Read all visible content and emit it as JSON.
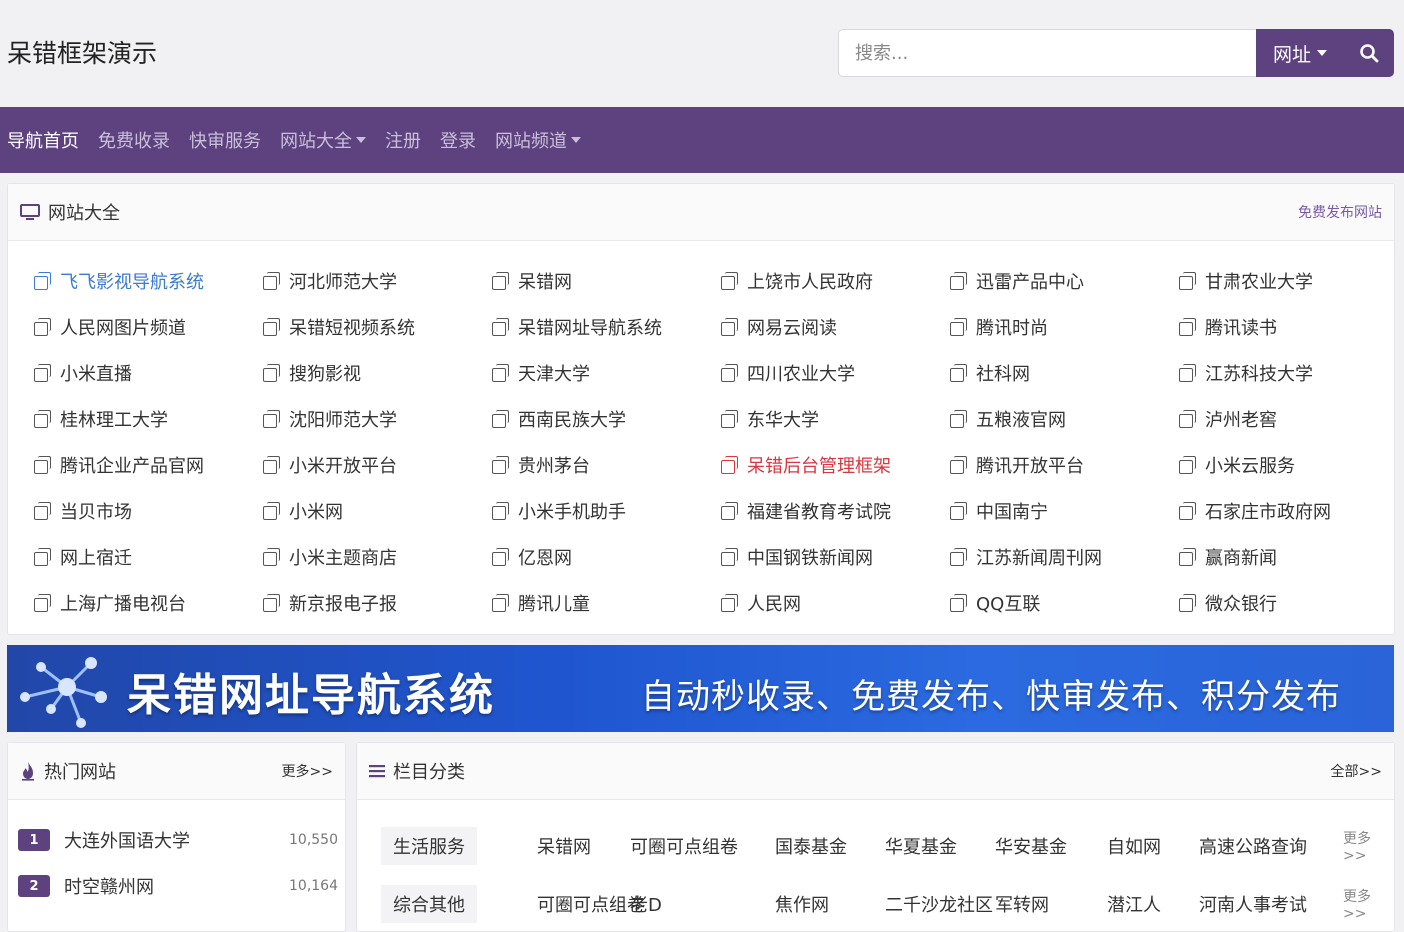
{
  "header": {
    "title": "呆错框架演示",
    "search_placeholder": "搜索...",
    "search_type": "网址"
  },
  "nav": {
    "items": [
      {
        "label": "导航首页",
        "active": true,
        "dropdown": false
      },
      {
        "label": "免费收录",
        "active": false,
        "dropdown": false
      },
      {
        "label": "快审服务",
        "active": false,
        "dropdown": false
      },
      {
        "label": "网站大全",
        "active": false,
        "dropdown": true
      },
      {
        "label": "注册",
        "active": false,
        "dropdown": false
      },
      {
        "label": "登录",
        "active": false,
        "dropdown": false
      },
      {
        "label": "网站频道",
        "active": false,
        "dropdown": true
      }
    ]
  },
  "sites_card": {
    "title": "网站大全",
    "right_link": "免费发布网站",
    "links": [
      {
        "label": "飞飞影视导航系统",
        "color": "#3b7bd0"
      },
      {
        "label": "河北师范大学",
        "color": "#333333"
      },
      {
        "label": "呆错网",
        "color": "#333333"
      },
      {
        "label": "上饶市人民政府",
        "color": "#333333"
      },
      {
        "label": "迅雷产品中心",
        "color": "#333333"
      },
      {
        "label": "甘肃农业大学",
        "color": "#333333"
      },
      {
        "label": "人民网图片频道",
        "color": "#333333"
      },
      {
        "label": "呆错短视频系统",
        "color": "#333333"
      },
      {
        "label": "呆错网址导航系统",
        "color": "#333333"
      },
      {
        "label": "网易云阅读",
        "color": "#333333"
      },
      {
        "label": "腾讯时尚",
        "color": "#333333"
      },
      {
        "label": "腾讯读书",
        "color": "#333333"
      },
      {
        "label": "小米直播",
        "color": "#333333"
      },
      {
        "label": "搜狗影视",
        "color": "#333333"
      },
      {
        "label": "天津大学",
        "color": "#333333"
      },
      {
        "label": "四川农业大学",
        "color": "#333333"
      },
      {
        "label": "社科网",
        "color": "#333333"
      },
      {
        "label": "江苏科技大学",
        "color": "#333333"
      },
      {
        "label": "桂林理工大学",
        "color": "#333333"
      },
      {
        "label": "沈阳师范大学",
        "color": "#333333"
      },
      {
        "label": "西南民族大学",
        "color": "#333333"
      },
      {
        "label": "东华大学",
        "color": "#333333"
      },
      {
        "label": "五粮液官网",
        "color": "#333333"
      },
      {
        "label": "泸州老窖",
        "color": "#333333"
      },
      {
        "label": "腾讯企业产品官网",
        "color": "#333333"
      },
      {
        "label": "小米开放平台",
        "color": "#333333"
      },
      {
        "label": "贵州茅台",
        "color": "#333333"
      },
      {
        "label": "呆错后台管理框架",
        "color": "#d9363e"
      },
      {
        "label": "腾讯开放平台",
        "color": "#333333"
      },
      {
        "label": "小米云服务",
        "color": "#333333"
      },
      {
        "label": "当贝市场",
        "color": "#333333"
      },
      {
        "label": "小米网",
        "color": "#333333"
      },
      {
        "label": "小米手机助手",
        "color": "#333333"
      },
      {
        "label": "福建省教育考试院",
        "color": "#333333"
      },
      {
        "label": "中国南宁",
        "color": "#333333"
      },
      {
        "label": "石家庄市政府网",
        "color": "#333333"
      },
      {
        "label": "网上宿迁",
        "color": "#333333"
      },
      {
        "label": "小米主题商店",
        "color": "#333333"
      },
      {
        "label": "亿恩网",
        "color": "#333333"
      },
      {
        "label": "中国钢铁新闻网",
        "color": "#333333"
      },
      {
        "label": "江苏新闻周刊网",
        "color": "#333333"
      },
      {
        "label": "赢商新闻",
        "color": "#333333"
      },
      {
        "label": "上海广播电视台",
        "color": "#333333"
      },
      {
        "label": "新京报电子报",
        "color": "#333333"
      },
      {
        "label": "腾讯儿童",
        "color": "#333333"
      },
      {
        "label": "人民网",
        "color": "#333333"
      },
      {
        "label": "QQ互联",
        "color": "#333333"
      },
      {
        "label": "微众银行",
        "color": "#333333"
      }
    ]
  },
  "banner": {
    "main": "呆错网址导航系统",
    "sub": "自动秒收录、免费发布、快审发布、积分发布"
  },
  "hot_sites": {
    "title": "热门网站",
    "more": "更多>>",
    "items": [
      {
        "rank": "1",
        "name": "大连外国语大学",
        "count": "10,550"
      },
      {
        "rank": "2",
        "name": "时空赣州网",
        "count": "10,164"
      }
    ]
  },
  "categories": {
    "title": "栏目分类",
    "more": "全部>>",
    "rows": [
      {
        "label": "生活服务",
        "items": [
          "呆错网",
          "可圈可点组卷",
          "国泰基金",
          "华夏基金",
          "华安基金",
          "自如网",
          "高速公路查询"
        ],
        "more": "更多>>"
      },
      {
        "label": "综合其他",
        "items": [
          "可圈可点组卷",
          "老D",
          "焦作网",
          "二千沙龙社区",
          "军转网",
          "潜江人",
          "河南人事考试"
        ],
        "more": "更多>>"
      }
    ]
  },
  "colors": {
    "brand": "#5e427f",
    "link_blue": "#3b7bd0",
    "link_red": "#d9363e",
    "right_link": "#7a5aa6"
  }
}
